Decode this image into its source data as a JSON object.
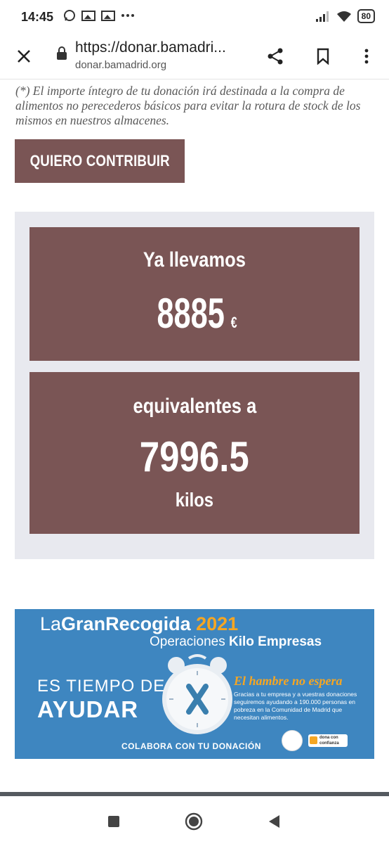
{
  "status": {
    "time": "14:45",
    "battery": "80"
  },
  "browser": {
    "url_display": "https://donar.bamadri...",
    "domain": "donar.bamadrid.org"
  },
  "page": {
    "disclaimer": "(*) El importe íntegro de tu donación irá destinada a la compra de alimentos no perecederos básicos para evitar la rotura de stock de los mismos en nuestros almacenes.",
    "cta_label": "QUIERO CONTRIBUIR",
    "counter": {
      "label1": "Ya llevamos",
      "amount": "8885",
      "currency": "€",
      "label2": "equivalentes a",
      "kilos": "7996.5",
      "kilos_unit": "kilos"
    },
    "banner": {
      "title_la": "La",
      "title_gran": "GranRecogida",
      "year": "2021",
      "subtitle_a": "Operaciones",
      "subtitle_b": "Kilo Empresas",
      "left_line1": "ES TIEMPO DE",
      "left_line2": "AYUDAR",
      "slogan": "El hambre no espera",
      "body": "Gracias a tu empresa y a vuestras donaciones seguiremos ayudando a 190.000 personas en pobreza en la Comunidad de Madrid que necesitan alimentos.",
      "cta": "COLABORA CON TU DONACIÓN",
      "partner_logo_text": "dona con confianza",
      "colors": {
        "background": "#3e86c0",
        "accent": "#f5a623"
      }
    },
    "colors": {
      "brand": "#7a5555",
      "panel": "#e8e9ef"
    }
  }
}
